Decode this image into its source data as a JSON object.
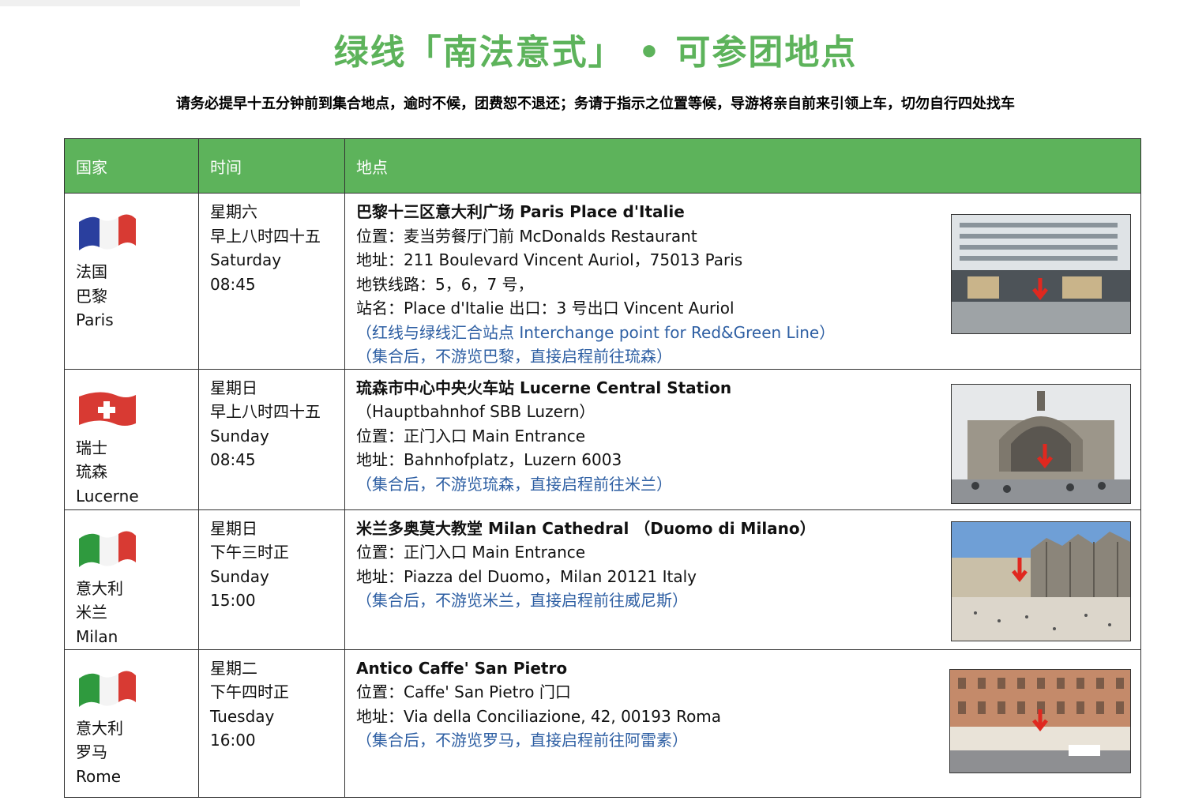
{
  "title": "绿线「南法意式」 •  可参团地点",
  "subtitle": "请务必提早十五分钟前到集合地点，逾时不候，团费恕不退还；务请于指示之位置等候，导游将亲自前来引领上车，切勿自行四处找车",
  "table": {
    "headers": [
      "国家",
      "时间",
      "地点"
    ],
    "rows": [
      {
        "flag": "france-flag",
        "country": [
          "法国",
          "巴黎",
          "Paris"
        ],
        "time": [
          "星期六",
          "早上八时四十五",
          "Saturday",
          "08:45"
        ],
        "title": "巴黎十三区意大利广场 Paris Place d'Italie",
        "details": [
          "位置：麦当劳餐厅门前 McDonalds Restaurant",
          "地址：211 Boulevard Vincent Auriol，75013 Paris",
          "地铁线路：5，6，7 号，",
          "站名：Place d'Italie 出口：3 号出口 Vincent Auriol"
        ],
        "notes": [
          "（红线与绿线汇合站点 Interchange point for Red&Green Line）",
          "（集合后，不游览巴黎，直接启程前往琉森）"
        ],
        "photo": "paris-building-photo"
      },
      {
        "flag": "switzerland-flag",
        "country": [
          "瑞士",
          "琉森",
          "Lucerne"
        ],
        "time": [
          "星期日",
          "早上八时四十五",
          "Sunday",
          "08:45"
        ],
        "title": "琉森市中心中央火车站 Lucerne Central Station",
        "details": [
          "（Hauptbahnhof SBB Luzern）",
          "位置：正门入口 Main Entrance",
          "地址：Bahnhofplatz，Luzern 6003"
        ],
        "notes": [
          "（集合后，不游览琉森，直接启程前往米兰）"
        ],
        "photo": "lucerne-station-photo"
      },
      {
        "flag": "italy-flag",
        "country": [
          "意大利",
          "米兰",
          "Milan"
        ],
        "time": [
          "星期日",
          "下午三时正",
          "Sunday",
          "15:00"
        ],
        "title": "米兰多奥莫大教堂 Milan Cathedral （Duomo di Milano）",
        "details": [
          "位置：正门入口 Main Entrance",
          "地址：Piazza del Duomo，Milan 20121 Italy"
        ],
        "notes": [
          "（集合后，不游览米兰，直接启程前往威尼斯）"
        ],
        "photo": "milan-cathedral-photo"
      },
      {
        "flag": "italy-flag",
        "country": [
          "意大利",
          "罗马",
          "Rome"
        ],
        "time": [
          "星期二",
          "下午四时正",
          "Tuesday",
          "16:00"
        ],
        "title": "Antico Caffe' San Pietro",
        "details": [
          "位置：Caffe' San Pietro 门口",
          "地址：Via della Conciliazione, 42, 00193 Roma"
        ],
        "notes": [
          "（集合后，不游览罗马，直接启程前往阿雷素）"
        ],
        "photo": "rome-cafe-photo"
      }
    ]
  },
  "colors": {
    "accent_green": "#5db35b",
    "note_blue": "#2e5fa3"
  }
}
